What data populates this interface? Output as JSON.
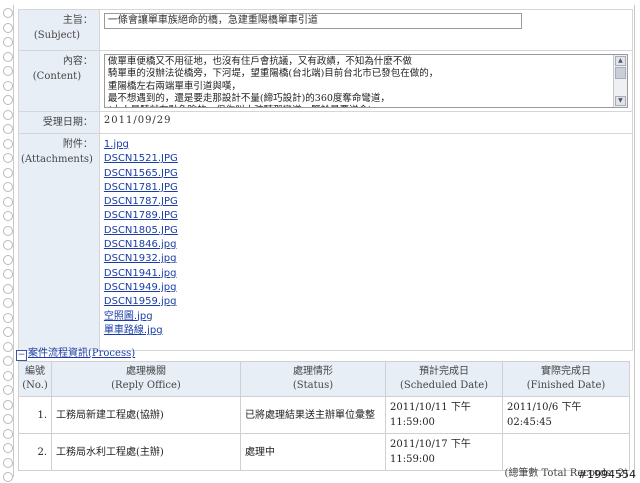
{
  "form": {
    "subject_label_zh": "主旨：",
    "subject_label_en": "(Subject)",
    "subject_value": "一條會讓單車族絕命的橋，急建重陽橋單車引道",
    "content_label_zh": "內容：",
    "content_label_en": "(Content)",
    "content_value": "做單車便橋又不用征地，也沒有住戶會抗議，又有政績，不知為什麼不做\n騎單車的沒辦法從橋旁，下河堤，望重陽橋(台北端)目前台北市已發包在做的，\n重陽橋左右兩端單車引道與嘆，\n最不想遇到的，還是要走那設計不量(締巧設計)的360度奪命彎道，\n(大人是騎就有點危險的，但你叫小孩騎那彎道，豎於是要送命)",
    "date_label": "受理日期：",
    "date_value": "2011/09/29",
    "attach_label_zh": "附件：",
    "attach_label_en": "(Attachments)",
    "attachments": [
      "1.jpg",
      "DSCN1521.JPG",
      "DSCN1565.JPG",
      "DSCN1781.JPG",
      "DSCN1787.JPG",
      "DSCN1789.JPG",
      "DSCN1805.JPG",
      "DSCN1846.jpg",
      "DSCN1932.jpg",
      "DSCN1941.jpg",
      "DSCN1949.jpg",
      "DSCN1959.jpg",
      "空照圖.jpg",
      "單車路線.jpg"
    ]
  },
  "process": {
    "toggle": "−",
    "title": "案件流程資訊(Process)",
    "headers": [
      {
        "zh": "編號",
        "en": "(No.)"
      },
      {
        "zh": "處理機關",
        "en": "(Reply Office)"
      },
      {
        "zh": "處理情形",
        "en": "(Status)"
      },
      {
        "zh": "預計完成日",
        "en": "(Scheduled Date)"
      },
      {
        "zh": "實際完成日",
        "en": "(Finished Date)"
      }
    ],
    "rows": [
      {
        "no": "1.",
        "office": "工務局新建工程處(協辦)",
        "status": "已將處理結果送主辦單位彙整",
        "scheduled": "2011/10/11 下午 11:59:00",
        "finished": "2011/10/6 下午 02:45:45"
      },
      {
        "no": "2.",
        "office": "工務局水利工程處(主辦)",
        "status": "處理中",
        "scheduled": "2011/10/17 下午 11:59:00",
        "finished": ""
      }
    ],
    "total": "(總筆數 Total Records: 2)"
  },
  "watermark": "#1994554"
}
